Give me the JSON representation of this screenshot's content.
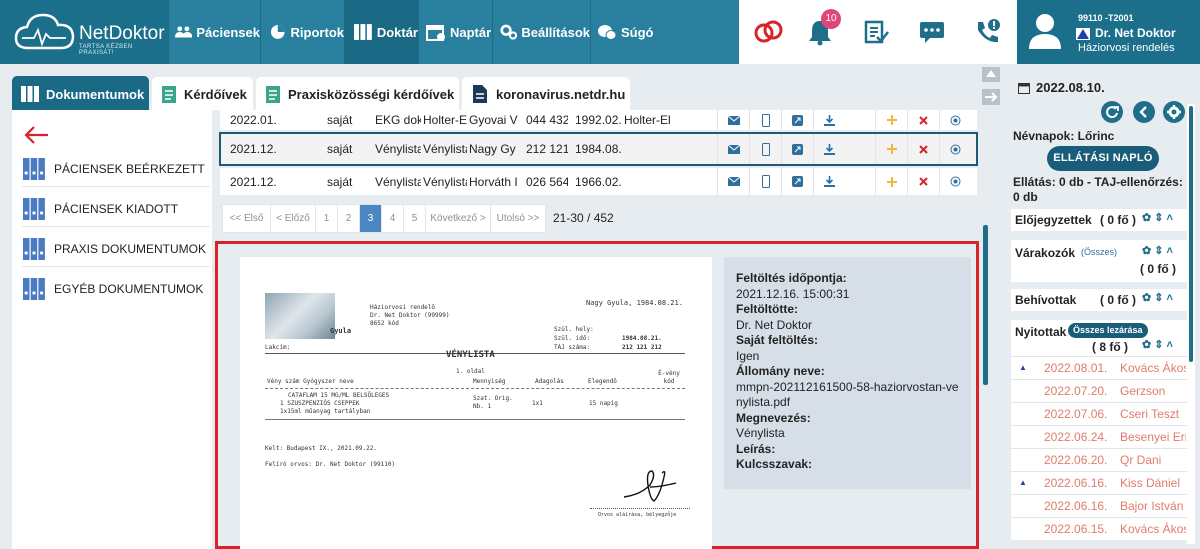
{
  "app": {
    "name": "NetDoktor",
    "tagline": "TARTSA KÉZBEN PRAXISÁT!"
  },
  "nav": {
    "items": [
      {
        "label": "Páciensek",
        "icon": "people-icon"
      },
      {
        "label": "Riportok",
        "icon": "chart-icon"
      },
      {
        "label": "Doktár",
        "icon": "binders-icon"
      },
      {
        "label": "Naptár",
        "icon": "calendar-icon"
      },
      {
        "label": "Beállítások",
        "icon": "gears-icon"
      },
      {
        "label": "Súgó",
        "icon": "help-icon"
      }
    ],
    "active": "Doktár"
  },
  "alerts": {
    "bell_count": "10"
  },
  "user": {
    "code": "99110 -T2001",
    "name": "Dr. Net Doktor",
    "role": "Háziorvosi rendelés"
  },
  "subtabs": [
    "Dokumentumok",
    "Kérdőívek",
    "Praxisközösségi kérdőívek",
    "koronavirus.netdr.hu"
  ],
  "leftnav": {
    "items": [
      "PÁCIENSEK BEÉRKEZETT",
      "PÁCIENSEK KIADOTT",
      "PRAXIS DOKUMENTUMOK",
      "EGYÉB DOKUMENTUMOK"
    ]
  },
  "table": {
    "rows": [
      {
        "date": "2022.01.",
        "type": "saját",
        "doc": "EKG dok",
        "name2": "Holter-El",
        "patient": "Gyovai V",
        "taj": "044 432",
        "born": "1992.02.",
        "desc": "Holter-El"
      },
      {
        "date": "2021.12.",
        "type": "saját",
        "doc": "Vénylista",
        "name2": "Vénylista",
        "patient": "Nagy Gy",
        "taj": "212 121",
        "born": "1984.08.",
        "desc": ""
      },
      {
        "date": "2021.12.",
        "type": "saját",
        "doc": "Vénylista",
        "name2": "Vénylista",
        "patient": "Horváth I",
        "taj": "026 564",
        "born": "1966.02.",
        "desc": ""
      }
    ]
  },
  "pager": {
    "first": "<< Első",
    "prev": "< Előző",
    "pages": [
      "1",
      "2",
      "3",
      "4",
      "5"
    ],
    "current": "3",
    "next": "Következő >",
    "last": "Utolsó >>",
    "range": "21-30 / 452"
  },
  "document": {
    "patient_header": "Nagy Gyula, 1984.08.21.",
    "practice_lines": [
      "Háziorvosi rendelő",
      "Dr. Net Doktor (99999)",
      "8652 kód"
    ],
    "patient_name_short": "Gyula",
    "address_label": "Lakcím:",
    "birth_place_label": "Szül. hely:",
    "birth_date_label": "Szül. idő:",
    "birth_date": "1984.08.21.",
    "taj_label": "TAJ száma:",
    "taj": "212 121 212",
    "title": "VÉNYLISTA",
    "page": "1. oldal",
    "cols": [
      "Vény szám Gyógyszer neve",
      "Mennyiség",
      "Adagolás",
      "Elegendő",
      "É-vény kód"
    ],
    "drug_lines": [
      "CATAFLAM 15 MG/ML BELSŐLEGES",
      "1 SZUSZPENZIÓS CSEPPEK",
      "1x15ml műanyag tartályban"
    ],
    "qty": "Szat. Orig.",
    "qty2": "Nb. 1",
    "dose": "1x1",
    "enough": "15 napig",
    "kelt": "Kelt:  Budapest IX., 2021.09.22.",
    "prescriber": "Felíró orvos: Dr. Net Doktor (99110)",
    "sign": "Orvos aláírása, bélyegzője"
  },
  "meta": {
    "uploaded_label": "Feltöltés időpontja:",
    "uploaded": "2021.12.16. 15:00:31",
    "uploader_label": "Feltöltötte:",
    "uploader": "Dr. Net Doktor",
    "own_label": "Saját feltöltés:",
    "own": "Igen",
    "file_label": "Állomány neve:",
    "file": "mmpn-202112161500-58-haziorvostan-venylista.pdf",
    "title_label": "Megnevezés:",
    "title": "Vénylista",
    "desc_label": "Leírás:",
    "keywords_label": "Kulcsszavak:"
  },
  "right": {
    "date": "2022.08.10.",
    "namedays": "Névnapok: Lőrinc",
    "log_button": "ELLÁTÁSI NAPLÓ",
    "care": "Ellátás: 0 db - TAJ-ellenőrzés: 0 db",
    "sections": [
      {
        "title": "Előjegyzettek",
        "count": "( 0 fő )"
      },
      {
        "title": "Várakozók",
        "link": "(Összes)",
        "count": "( 0 fő )"
      },
      {
        "title": "Behívottak",
        "count": "( 0 fő )"
      },
      {
        "title": "Nyitottak",
        "badge": "Összes lezárása",
        "count": "( 8 fő )"
      }
    ],
    "open_list": [
      {
        "date": "2022.08.01.",
        "name": "Kovács Ákos",
        "flag": "▲"
      },
      {
        "date": "2022.07.20.",
        "name": "Gerzson",
        "flag": ""
      },
      {
        "date": "2022.07.06.",
        "name": "Cseri Teszt",
        "flag": ""
      },
      {
        "date": "2022.06.24.",
        "name": "Besenyei Eri",
        "flag": ""
      },
      {
        "date": "2022.06.20.",
        "name": "Qr Dani",
        "flag": ""
      },
      {
        "date": "2022.06.16.",
        "name": "Kiss Dániel",
        "flag": "▲"
      },
      {
        "date": "2022.06.16.",
        "name": "Bajor István",
        "flag": ""
      },
      {
        "date": "2022.06.15.",
        "name": "Kovács Ákos",
        "flag": ""
      }
    ]
  }
}
